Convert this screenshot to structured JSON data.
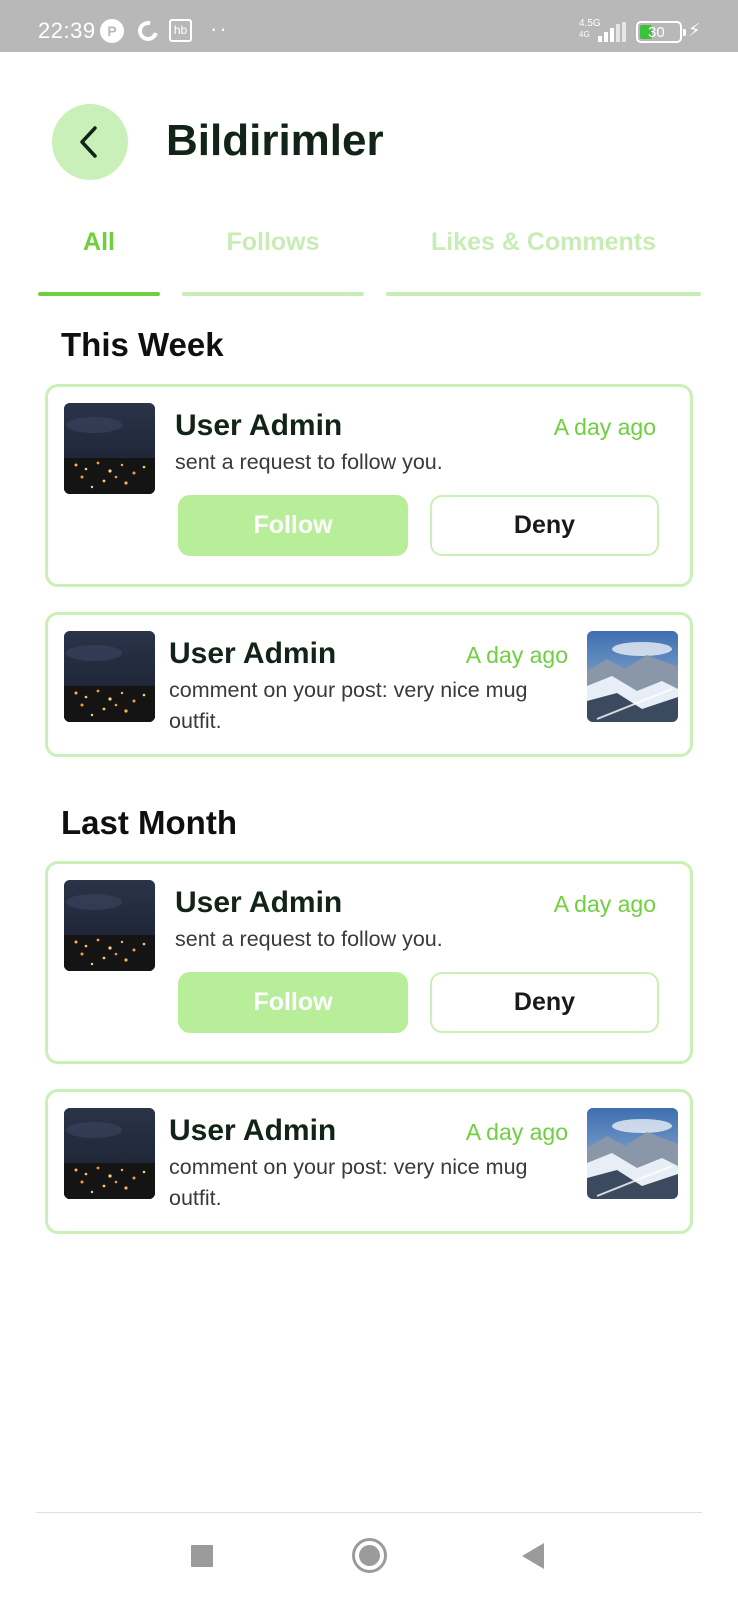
{
  "status_bar": {
    "time": "22:39",
    "network_label_top": "4.5G",
    "network_label_bottom": "4G",
    "battery": "30",
    "icons": [
      "notification-p-icon",
      "moon-icon",
      "hb-app-icon",
      "more-dots-icon",
      "signal-icon",
      "battery-icon",
      "charging-bolt-icon"
    ]
  },
  "header": {
    "title": "Bildirimler",
    "back_icon": "chevron-left-icon"
  },
  "tabs": [
    {
      "label": "All",
      "active": true
    },
    {
      "label": "Follows",
      "active": false
    },
    {
      "label": "Likes & Comments",
      "active": false
    }
  ],
  "sections": [
    {
      "title": "This Week",
      "items": [
        {
          "type": "follow_request",
          "user": "User Admin",
          "time": "A day ago",
          "message": "sent a request to follow you.",
          "follow_label": "Follow",
          "deny_label": "Deny"
        },
        {
          "type": "comment",
          "user": "User Admin",
          "time": "A day ago",
          "message": "comment on your post: very nice mug outfit."
        }
      ]
    },
    {
      "title": "Last Month",
      "items": [
        {
          "type": "follow_request",
          "user": "User Admin",
          "time": "A day ago",
          "message": "sent a request to follow you.",
          "follow_label": "Follow",
          "deny_label": "Deny"
        },
        {
          "type": "comment",
          "user": "User Admin",
          "time": "A day ago",
          "message": "comment on your post: very nice mug outfit."
        }
      ]
    }
  ],
  "nav_bar": {
    "icons": [
      "recent-apps-icon",
      "home-icon",
      "back-triangle-icon"
    ]
  },
  "colors": {
    "accent": "#6fcf3f",
    "accent_light": "#c9f0b6",
    "follow_button": "#b8ee9a",
    "back_button_bg": "#c8f0b8",
    "status_bar": "#b8b8b8"
  }
}
